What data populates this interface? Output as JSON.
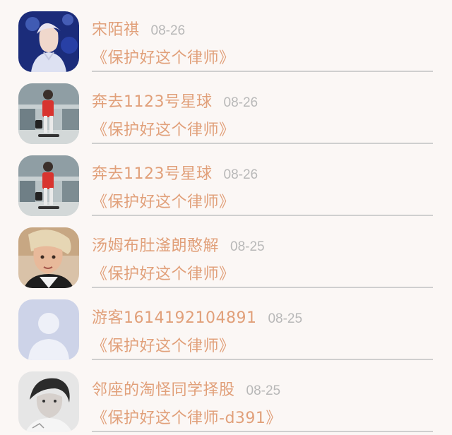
{
  "colors": {
    "name": "#e1a07a",
    "date": "#b8b8b8",
    "title": "#e1a07a",
    "divider": "#cfcfcf",
    "background": "#fbf7f5"
  },
  "items": [
    {
      "name": "宋陌祺",
      "date": "08-26",
      "title": "《保护好这个律师》",
      "avatar": "avatar-photo-singer-icon"
    },
    {
      "name": "奔去1123号星球",
      "date": "08-26",
      "title": "《保护好这个律师》",
      "avatar": "avatar-photo-street-icon"
    },
    {
      "name": "奔去1123号星球",
      "date": "08-26",
      "title": "《保护好这个律师》",
      "avatar": "avatar-photo-street-icon"
    },
    {
      "name": "汤姆布肚滏朗憨解",
      "date": "08-25",
      "title": "《保护好这个律师》",
      "avatar": "avatar-photo-face-icon"
    },
    {
      "name": "游客1614192104891",
      "date": "08-25",
      "title": "《保护好这个律师》",
      "avatar": "default-user-avatar-icon"
    },
    {
      "name": "邻座的淘怪同学择股",
      "date": "08-25",
      "title": "《保护好这个律师-d391》",
      "avatar": "avatar-photo-grayscale-icon"
    }
  ]
}
